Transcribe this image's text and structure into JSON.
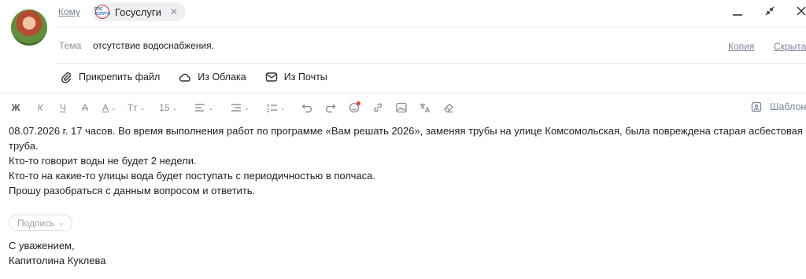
{
  "header": {
    "to_label": "Кому",
    "recipient": {
      "name": "Госуслуги",
      "logo_text": "ГОС УСЛУГИ",
      "remove_icon": "close-icon"
    },
    "subject_label": "Тема",
    "subject_value": "отсутствие водоснабжения.",
    "cc_label": "Копия",
    "bcc_label": "Скрыта",
    "window": {
      "minimize": "minimize-icon",
      "collapse": "collapse-icon",
      "close": "close-icon"
    }
  },
  "attachments": {
    "attach_file": "Прикрепить файл",
    "from_cloud": "Из Облака",
    "from_mail": "Из Почты"
  },
  "toolbar": {
    "bold": "Ж",
    "italic": "К",
    "underline": "Ч",
    "strike": "А",
    "text_color": "А",
    "font_style": "Тт",
    "font_size": "15",
    "template_label": "Шаблон"
  },
  "body": {
    "paragraphs": [
      "08.07.2026 г. 17 часов. Во время выполнения работ по программе «Вам решать 2026», заменяя трубы на улице Комсомольская, была повреждена старая асбестовая труба.",
      "Кто-то говорит воды не будет 2 недели.",
      "Кто-то на какие-то улицы вода будет поступать с периодичностью в полчаса.",
      "Прошу разобраться с данным вопросом и ответить."
    ]
  },
  "signature": {
    "button_label": "Подпись",
    "lines": [
      "С уважением,",
      "Капитолина Куклева"
    ]
  },
  "colors": {
    "accent_error_dot": "#e53935",
    "link_gray": "#7a8699"
  }
}
